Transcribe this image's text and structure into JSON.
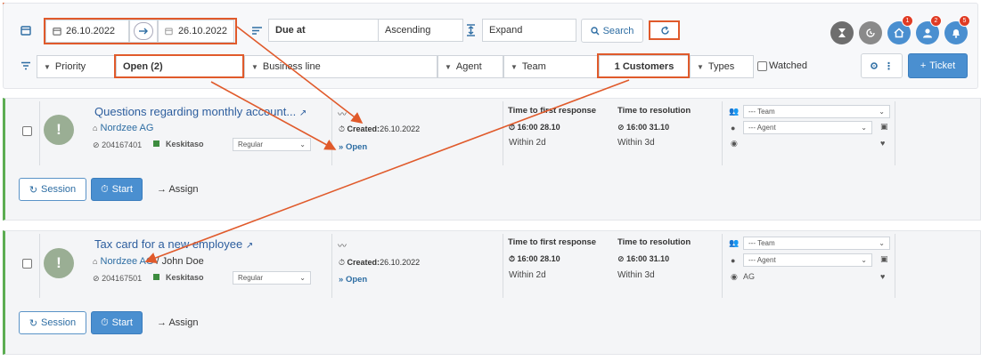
{
  "toolbar": {
    "date_from": "26.10.2022",
    "date_to": "26.10.2022",
    "sort_field": "Due at",
    "sort_order": "Ascending",
    "expand_label": "Expand",
    "search_label": "Search",
    "badges": {
      "home": "1",
      "user": "2",
      "bell": "5"
    },
    "filters": {
      "priority": "Priority",
      "status": "Open (2)",
      "business_line": "Business line",
      "agent": "Agent",
      "team": "Team",
      "customers": "1 Customers",
      "types": "Types",
      "watched": "Watched"
    },
    "ticket_label": "Ticket"
  },
  "tickets": [
    {
      "title": "Questions regarding monthly account...",
      "customer": "Nordzee AG",
      "contact": "",
      "id": "204167401",
      "level": "Keskitaso",
      "category": "Regular",
      "created_label": "Created:",
      "created": "26.10.2022",
      "status": "Open",
      "ttfr_header": "Time to first response",
      "ttfr_time": "16:00 28.10",
      "ttfr_within": "Within 2d",
      "ttr_header": "Time to resolution",
      "ttr_time": "16:00 31.10",
      "ttr_within": "Within 3d",
      "team": "--- Team",
      "agent": "--- Agent",
      "watcher": "",
      "session_label": "Session",
      "start_label": "Start",
      "assign_label": "Assign"
    },
    {
      "title": "Tax card for a new employee",
      "customer": "Nordzee AG",
      "contact": "/ John Doe",
      "id": "204167501",
      "level": "Keskitaso",
      "category": "Regular",
      "created_label": "Created:",
      "created": "26.10.2022",
      "status": "Open",
      "ttfr_header": "Time to first response",
      "ttfr_time": "16:00 28.10",
      "ttfr_within": "Within 2d",
      "ttr_header": "Time to resolution",
      "ttr_time": "16:00 31.10",
      "ttr_within": "Within 3d",
      "team": "--- Team",
      "agent": "--- Agent",
      "watcher": "AG",
      "session_label": "Session",
      "start_label": "Start",
      "assign_label": "Assign"
    }
  ],
  "colors": {
    "accent": "#4a8fd0",
    "link": "#2d5e9e",
    "status_green": "#5cad52",
    "badge_red": "#e03b24",
    "annotation": "#e05a2b"
  }
}
